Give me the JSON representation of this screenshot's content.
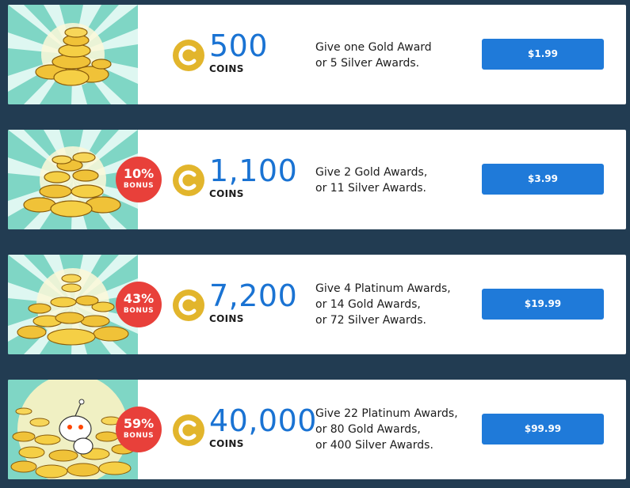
{
  "coins_label": "COINS",
  "bonus_label": "BONUS",
  "colors": {
    "background": "#223c52",
    "amount": "#1a73d3",
    "button": "#1f7ad9",
    "bonus_badge": "#e8403a",
    "coin": "#e2b52c",
    "thumb_bg": "#7fd6c5"
  },
  "packages": [
    {
      "image_icon": "coin-pile-small",
      "amount": "500",
      "bonus": null,
      "description": [
        "Give one Gold Award",
        "or 5 Silver Awards."
      ],
      "price": "$1.99"
    },
    {
      "image_icon": "coin-pile-medium",
      "amount": "1,100",
      "bonus": "10%",
      "description": [
        "Give 2 Gold Awards,",
        "or 11 Silver Awards."
      ],
      "price": "$3.99"
    },
    {
      "image_icon": "coin-pile-large",
      "amount": "7,200",
      "bonus": "43%",
      "description": [
        "Give 4 Platinum Awards,",
        "or 14 Gold Awards,",
        "or 72 Silver Awards."
      ],
      "price": "$19.99"
    },
    {
      "image_icon": "coin-pile-huge-with-snoo",
      "amount": "40,000",
      "bonus": "59%",
      "description": [
        "Give 22 Platinum Awards,",
        "or 80 Gold Awards,",
        "or 400 Silver Awards."
      ],
      "price": "$99.99"
    }
  ]
}
